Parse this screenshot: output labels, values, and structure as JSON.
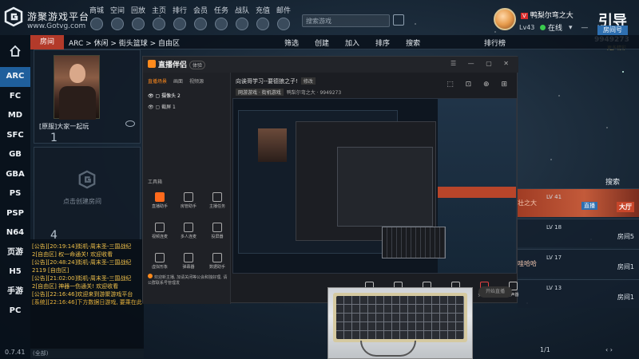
{
  "app": {
    "brand": "游聚游戏平台",
    "brand_url": "www.Gotvg.com",
    "version": "0.7.41"
  },
  "topnav": [
    {
      "label": "商城",
      "icon": "shop-icon"
    },
    {
      "label": "空间",
      "icon": "space-icon"
    },
    {
      "label": "回放",
      "icon": "replay-icon"
    },
    {
      "label": "主页",
      "icon": "home-icon"
    },
    {
      "label": "排行",
      "icon": "rank-icon"
    },
    {
      "label": "会员",
      "icon": "vip-icon"
    },
    {
      "label": "任务",
      "icon": "task-icon"
    },
    {
      "label": "战队",
      "icon": "team-icon"
    },
    {
      "label": "充值",
      "icon": "recharge-icon"
    },
    {
      "label": "邮件",
      "icon": "mail-icon"
    }
  ],
  "search": {
    "placeholder": "搜索游戏"
  },
  "user": {
    "vip": "V",
    "name": "鸭梨尔弯之大",
    "level": "Lv43",
    "status": "在线"
  },
  "room_badge": {
    "tag": "引导",
    "label": "房间号",
    "number": "9949273",
    "sub": "更多精彩"
  },
  "sidebar": {
    "items": [
      "ARC",
      "FC",
      "MD",
      "SFC",
      "GB",
      "GBA",
      "PS",
      "PSP",
      "N64",
      "页游",
      "H5",
      "手游",
      "PC"
    ],
    "active": "ARC"
  },
  "breadcrumb": {
    "room_label": "房间",
    "path": "ARC > 休闲 > 街头篮球 > 自由区",
    "actions": [
      "筛选",
      "创建",
      "加入",
      "排序",
      "搜索"
    ],
    "ranking": "排行榜"
  },
  "rooms": [
    {
      "title": "[原服]大家一起玩",
      "count": "1"
    },
    {
      "title": "点击创建房间",
      "count": "4"
    }
  ],
  "chat": [
    {
      "text": "[公告][20:19:14]街机-周末圣-三国战纪2[自由区] 权一命通关! 欢迎收看",
      "type": "notice"
    },
    {
      "text": "[公告][20:48:24]街机-周末圣-三国战纪2119 [自由区]",
      "type": "notice"
    },
    {
      "text": "[公告][21:02:00]街机-周末圣-三国战纪2[自由区] 神器一伤通关! 欢迎收看",
      "type": "notice"
    },
    {
      "text": "[公告][22:16:46]欢迎来到游聚游戏平台",
      "type": "notice"
    },
    {
      "text": "[系统][22:16:46]下方数据日游戏, 要乘在此",
      "type": "sys"
    }
  ],
  "chat_input": {
    "placeholder": "(全部)"
  },
  "right_list": {
    "search_label": "搜索",
    "rows": [
      {
        "name": "壮之大",
        "level": "LV 41",
        "room": "大厅",
        "highlight": true,
        "tag": "直播"
      },
      {
        "name": "",
        "level": "LV 18",
        "room": "房间5",
        "highlight": false
      },
      {
        "name": "哇哈哈",
        "level": "LV 17",
        "room": "房间1",
        "highlight": false
      },
      {
        "name": "",
        "level": "LV 13",
        "room": "房间1",
        "highlight": false
      }
    ],
    "page": "1/1"
  },
  "streamer": {
    "app_name": "直播伴侣",
    "version": "体验",
    "tabs": [
      "直播场景",
      "画面",
      "视频源"
    ],
    "active_tab": "直播场景",
    "scenes": [
      "摄像头 2",
      "截屏 1"
    ],
    "tools_title": "工具箱",
    "tools": [
      {
        "label": "直播助手",
        "hot": true
      },
      {
        "label": "房管助手",
        "hot": false
      },
      {
        "label": "主播任务",
        "hot": false
      },
      {
        "label": "视频连麦",
        "hot": false
      },
      {
        "label": "多人连麦",
        "hot": false
      },
      {
        "label": "投屏器",
        "hot": false
      },
      {
        "label": "虚拟形象",
        "hot": false
      },
      {
        "label": "弹幕器",
        "hot": false
      },
      {
        "label": "数据助手",
        "hot": false
      }
    ],
    "stream_title": "向诶哥学习--要德狼之子!",
    "edit_chip": "修改",
    "category_chip": "网游游戏 · 街机游戏",
    "id_text": "鸭梨尔弯之大 · 9949273",
    "bottom_buttons": [
      "直播屏幕",
      "摄像头",
      "手机投屏",
      "多媒体",
      "麦克风",
      "扬声器"
    ],
    "golive_label": "开始直播",
    "notice": "欢迎新主播, 加请关闭等公会和独好理, 请公群联系号管理发"
  }
}
